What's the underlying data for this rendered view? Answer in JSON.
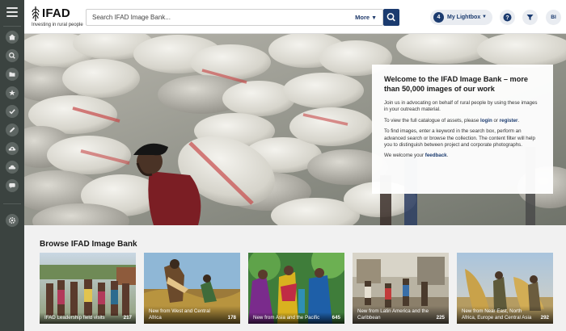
{
  "header": {
    "logo_name": "IFAD",
    "logo_tagline": "Investing in rural people",
    "search_placeholder": "Search IFAD Image Bank...",
    "more_label": "More",
    "lightbox_count": "4",
    "lightbox_label": "My Lightbox",
    "user_initials": "BI"
  },
  "rail": {
    "items": [
      "home-icon",
      "search-icon",
      "folder-icon",
      "star-icon",
      "check-icon",
      "pencil-icon",
      "upload-cloud-icon",
      "cloud-icon",
      "chat-icon",
      "settings-icon"
    ]
  },
  "welcome": {
    "title": "Welcome to the IFAD Image Bank – more than 50,000 images of our work",
    "p1": "Join us in advocating on behalf of rural people by using these images in your outreach material.",
    "p2_prefix": "To view the full catalogue of assets, please ",
    "login_label": "login",
    "p2_mid": " or ",
    "register_label": "register",
    "p2_suffix": ".",
    "p3": "To find images, enter a keyword in the search box, perform an advanced search or browse the collection. The content filter will help you to distinguish between project and corporate photographs.",
    "p4_prefix": "We welcome your ",
    "feedback_label": "feedback",
    "p4_suffix": "."
  },
  "browse": {
    "title": "Browse IFAD Image Bank",
    "cards": [
      {
        "title": "IFAD Leadership field visits",
        "count": "217"
      },
      {
        "title": "New from West and Central Africa",
        "count": "178"
      },
      {
        "title": "New from Asia and the Pacific",
        "count": "645"
      },
      {
        "title": "New from Latin America and the Caribbean",
        "count": "225"
      },
      {
        "title": "New from Near East, North Africa, Europe and Central Asia",
        "count": "292"
      }
    ]
  },
  "colors": {
    "rail": "#3b4340",
    "accent": "#1b3b6f",
    "page_bg": "#f1f1f1"
  }
}
